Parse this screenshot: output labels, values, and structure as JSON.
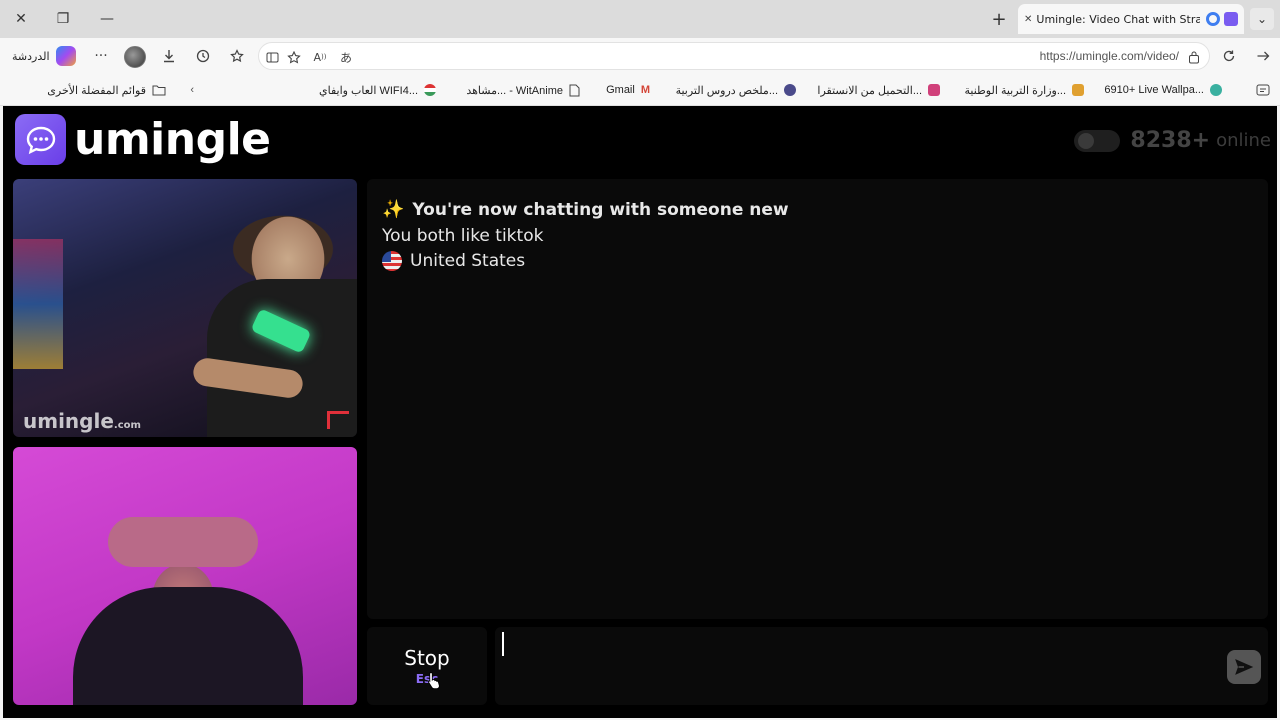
{
  "browser": {
    "tab": {
      "title": "Umingle: Video Chat with Stra",
      "close_glyph": "✕"
    },
    "window_controls": {
      "close": "✕",
      "restore": "❐",
      "minimize": "—"
    },
    "new_tab_glyph": "+",
    "dropdown_glyph": "⌄",
    "toolbar": {
      "chat_label": "الدردشة",
      "more_glyph": "···"
    },
    "address": {
      "url": "https://umingle.com/video/"
    },
    "bookmarks": [
      {
        "label": "6910+ Live Wallpa...",
        "color": "#3ab0a0"
      },
      {
        "label": "وزارة التربية الوطنية...",
        "color": "#e0a030"
      },
      {
        "label": "التحميل من الانستقرا...",
        "color": "#d0407a"
      },
      {
        "label": "ملخص دروس التربية...",
        "color": "#4a4a8a"
      },
      {
        "label": "Gmail",
        "color": "#d44638"
      },
      {
        "label": "مشاهد... - WitAnime",
        "color": "#888888"
      },
      {
        "label": "العاب وايفاي WIFI4...",
        "color": "#3a9a5a"
      }
    ],
    "other_favorites": "قوائم المفضلة الأخرى"
  },
  "site": {
    "logo_text": "umingle",
    "online_count": "8238+",
    "online_label": "online",
    "accent": "#8b6cf5",
    "video_watermark": "umingle",
    "video_watermark_suffix": ".com"
  },
  "chat": {
    "headline": "You're now chatting with someone new",
    "common_interest": "You both like tiktok",
    "country": "United States",
    "sparkle": "✨"
  },
  "controls": {
    "stop_label": "Stop",
    "stop_key": "Esc",
    "input_value": "",
    "send_glyph": "➤"
  }
}
